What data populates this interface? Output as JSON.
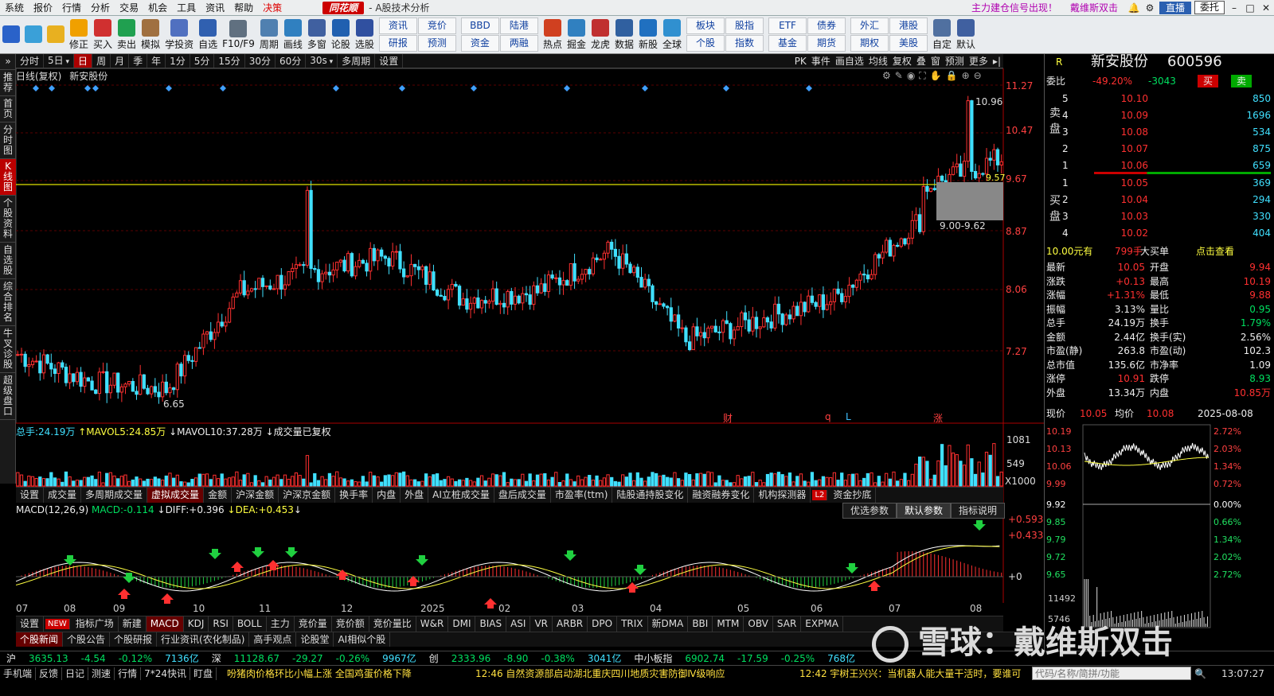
{
  "menubar": {
    "items": [
      "系统",
      "报价",
      "行情",
      "分析",
      "交易",
      "机会",
      "工具",
      "资讯",
      "帮助",
      "决策"
    ],
    "brand": "同花顺",
    "subtitle": "- A股技术分析",
    "promo1": "主力建仓信号出现！",
    "promo2": "戴维斯双击",
    "live": "直播",
    "commission": "委托",
    "win_min": "–",
    "win_max": "□",
    "win_close": "✕"
  },
  "toolbar": {
    "buttons": [
      {
        "label": "",
        "color": "#2a62c9"
      },
      {
        "label": "",
        "color": "#3aa0d8"
      },
      {
        "label": "",
        "color": "#e8b020"
      },
      {
        "label": "修正",
        "color": "#f0a000"
      },
      {
        "label": "买入",
        "color": "#d03030"
      },
      {
        "label": "卖出",
        "color": "#20a050"
      },
      {
        "label": "模拟",
        "color": "#a07040"
      },
      {
        "label": "学投资",
        "color": "#5070c0"
      },
      {
        "label": "自选",
        "color": "#3060b0"
      },
      {
        "label": "F10/F9",
        "color": "#607080"
      },
      {
        "label": "周期",
        "color": "#5080b0"
      },
      {
        "label": "画线",
        "color": "#3080c0"
      },
      {
        "label": "多窗",
        "color": "#4060a0"
      },
      {
        "label": "论股",
        "color": "#2060b0"
      },
      {
        "label": "选股",
        "color": "#3050a0"
      }
    ],
    "grid1": [
      "资讯",
      "竞价",
      "研报",
      "预测"
    ],
    "grid2": [
      "BBD",
      "陆港",
      "资金",
      "两融"
    ],
    "buttons2": [
      {
        "label": "热点",
        "color": "#d04020"
      },
      {
        "label": "掘金",
        "color": "#3080c0"
      },
      {
        "label": "龙虎",
        "color": "#c03030"
      },
      {
        "label": "数据",
        "color": "#3060a0"
      },
      {
        "label": "新股",
        "color": "#2070c0"
      },
      {
        "label": "全球",
        "color": "#3090d0"
      }
    ],
    "grid3": [
      "板块",
      "股指",
      "个股",
      "指数"
    ],
    "grid4": [
      "ETF",
      "债券",
      "基金",
      "期货"
    ],
    "grid5": [
      "外汇",
      "港股",
      "期权",
      "美股"
    ],
    "buttons3": [
      {
        "label": "自定",
        "color": "#5070a0"
      },
      {
        "label": "默认",
        "color": "#4060a0"
      }
    ]
  },
  "leftnav": [
    {
      "label": "推荐",
      "active": false
    },
    {
      "label": "首页",
      "active": false
    },
    {
      "label": "分时图",
      "active": false
    },
    {
      "label": "K线图",
      "active": true
    },
    {
      "label": "个股资料",
      "active": false
    },
    {
      "label": "自选股",
      "active": false
    },
    {
      "label": "综合排名",
      "active": false
    },
    {
      "label": "牛叉诊股",
      "active": false
    },
    {
      "label": "超级盘口",
      "active": false
    }
  ],
  "periodbar": {
    "tabs": [
      {
        "label": "分时",
        "drop": false
      },
      {
        "label": "5日",
        "drop": true
      },
      {
        "label": "日",
        "drop": false,
        "active": true
      },
      {
        "label": "周",
        "drop": false
      },
      {
        "label": "月",
        "drop": false
      },
      {
        "label": "季",
        "drop": false
      },
      {
        "label": "年",
        "drop": false
      },
      {
        "label": "1分",
        "drop": false
      },
      {
        "label": "5分",
        "drop": false
      },
      {
        "label": "15分",
        "drop": false
      },
      {
        "label": "30分",
        "drop": false
      },
      {
        "label": "60分",
        "drop": false
      },
      {
        "label": "30s",
        "drop": true
      },
      {
        "label": "多周期",
        "drop": false
      },
      {
        "label": "设置",
        "drop": false
      }
    ],
    "right": [
      "PK",
      "事件",
      "画自选",
      "均线",
      "复权",
      "叠",
      "窗",
      "预测",
      "更多"
    ]
  },
  "kline": {
    "title": "日线(复权)",
    "stock": "新安股份",
    "high_label": "10.96",
    "low_label": "6.65",
    "zone_label": "9.00-9.62",
    "line_label": "9.57",
    "markers": [
      "财",
      "q",
      "L",
      "涨"
    ],
    "price_axis": [
      "11.27",
      "10.47",
      "9.67",
      "8.87",
      "8.06",
      "7.27"
    ]
  },
  "volume": {
    "total_label": "总手:",
    "total": "24.19万",
    "ma5_label": "MAVOL5:",
    "ma5": "24.85万",
    "ma10_label": "MAVOL10:",
    "ma10": "37.28万",
    "note": "成交量已复权",
    "axis": [
      "1081",
      "549",
      "X1000"
    ]
  },
  "tabs1": [
    "设置",
    "成交量",
    "多周期成交量",
    "虚拟成交量",
    "金额",
    "沪深金额",
    "沪深京金额",
    "换手率",
    "内盘",
    "外盘",
    "AI立桩成交量",
    "盘后成交量",
    "市盈率(ttm)",
    "陆股通持股变化",
    "融资融券变化",
    "机构探测器",
    "L2",
    "资金抄底"
  ],
  "macd": {
    "title": "MACD(12,26,9)",
    "macd_label": "MACD:",
    "macd": "-0.114",
    "diff_label": "DIFF:",
    "diff": "+0.396",
    "dea_label": "DEA:",
    "dea": "+0.453",
    "axis": [
      "+0.593",
      "+0.433",
      "+0"
    ],
    "opts": [
      "优选参数",
      "默认参数",
      "指标说明"
    ]
  },
  "months": [
    "07",
    "08",
    "09",
    "10",
    "11",
    "12",
    "2025",
    "02",
    "03",
    "04",
    "05",
    "06",
    "07",
    "08"
  ],
  "tabs2": [
    "设置",
    "NEW",
    "指标广场",
    "新建",
    "MACD",
    "KDJ",
    "RSI",
    "BOLL",
    "主力",
    "竞价量",
    "竞价额",
    "竞价量比",
    "W&R",
    "DMI",
    "BIAS",
    "ASI",
    "VR",
    "ARBR",
    "DPO",
    "TRIX",
    "新DMA",
    "BBI",
    "MTM",
    "OBV",
    "SAR",
    "EXPMA"
  ],
  "tabs3": [
    "个股新闻",
    "个股公告",
    "个股研报",
    "行业资讯(农化制品)",
    "高手观点",
    "论股堂",
    "AI相似个股"
  ],
  "index": [
    {
      "name": "沪",
      "val": "3635.13",
      "chg": "-4.54",
      "pct": "-0.12%",
      "amt": "7136亿"
    },
    {
      "name": "深",
      "val": "11128.67",
      "chg": "-29.27",
      "pct": "-0.26%",
      "amt": "9967亿"
    },
    {
      "name": "创",
      "val": "2333.96",
      "chg": "-8.90",
      "pct": "-0.38%",
      "amt": "3041亿"
    },
    {
      "name": "中小板指",
      "val": "6902.74",
      "chg": "-17.59",
      "pct": "-0.25%",
      "amt": "768亿"
    }
  ],
  "status": {
    "items": [
      "手机端",
      "反馈",
      "日记",
      "测速",
      "行情",
      "7*24快讯",
      "盯盘"
    ],
    "news1": "吩猪肉价格环比小幅上涨 全国鸡蛋价格下降",
    "news2": "12:46 自然资源部启动湖北重庆四川地质灾害防御Ⅳ级响应",
    "news3": "12:42 宇树王兴兴：当机器人能大量干活时，要谁可",
    "search_placeholder": "代码/名称/简拼/功能",
    "time": "13:07:27"
  },
  "right": {
    "r": "R",
    "name": "新安股份",
    "code": "600596",
    "weibi_label": "委比",
    "weibi": "-49.20%",
    "weicha": "-3043",
    "buy_btn": "买",
    "sell_btn": "卖",
    "sell_label": "卖盘",
    "buy_label": "买盘",
    "asks": [
      {
        "lv": "5",
        "p": "10.10",
        "v": "850"
      },
      {
        "lv": "4",
        "p": "10.09",
        "v": "1696"
      },
      {
        "lv": "3",
        "p": "10.08",
        "v": "534"
      },
      {
        "lv": "2",
        "p": "10.07",
        "v": "875"
      },
      {
        "lv": "1",
        "p": "10.06",
        "v": "659"
      }
    ],
    "bids": [
      {
        "lv": "1",
        "p": "10.05",
        "v": "369"
      },
      {
        "lv": "2",
        "p": "10.04",
        "v": "294"
      },
      {
        "lv": "3",
        "p": "10.03",
        "v": "330"
      },
      {
        "lv": "4",
        "p": "10.02",
        "v": "404"
      }
    ],
    "big_price": "10.00元有",
    "big_hands": "799手",
    "big_text": "大买单",
    "big_link": "点击查看",
    "quote": [
      [
        "最新",
        "10.05",
        "开盘",
        "9.94"
      ],
      [
        "涨跌",
        "+0.13",
        "最高",
        "10.19"
      ],
      [
        "涨幅",
        "+1.31%",
        "最低",
        "9.88"
      ],
      [
        "振幅",
        "3.13%",
        "量比",
        "0.95"
      ],
      [
        "总手",
        "24.19万",
        "换手",
        "1.79%"
      ],
      [
        "金额",
        "2.44亿",
        "换手(实)",
        "2.56%"
      ],
      [
        "市盈(静)",
        "263.8",
        "市盈(动)",
        "102.3"
      ],
      [
        "总市值",
        "135.6亿",
        "市净率",
        "1.09"
      ],
      [
        "涨停",
        "10.91",
        "跌停",
        "8.93"
      ],
      [
        "外盘",
        "13.34万",
        "内盘",
        "10.85万"
      ]
    ],
    "mini": {
      "now_label": "现价",
      "now": "10.05",
      "avg_label": "均价",
      "avg": "10.08",
      "date": "2025-08-08",
      "left_axis": [
        "10.19",
        "10.13",
        "10.06",
        "9.99",
        "9.92",
        "9.85",
        "9.79",
        "9.72",
        "9.65"
      ],
      "right_axis": [
        "2.72%",
        "2.03%",
        "1.34%",
        "0.72%",
        "0.00%",
        "0.66%",
        "1.34%",
        "2.02%",
        "2.72%"
      ],
      "vol_axis": [
        "11492",
        "5746"
      ]
    }
  },
  "watermark": "雪球：戴维斯双击",
  "chart_data": {
    "type": "candlestick",
    "x_range": [
      "2024-07",
      "2025-08"
    ],
    "ylim": [
      6.65,
      11.27
    ],
    "monthly_closes": [
      {
        "m": "07",
        "v": 7.4
      },
      {
        "m": "08",
        "v": 7.0
      },
      {
        "m": "09",
        "v": 6.9
      },
      {
        "m": "10",
        "v": 8.3
      },
      {
        "m": "11",
        "v": 8.6
      },
      {
        "m": "12",
        "v": 8.8
      },
      {
        "m": "2025",
        "v": 8.2
      },
      {
        "m": "02",
        "v": 8.3
      },
      {
        "m": "03",
        "v": 8.9
      },
      {
        "m": "04",
        "v": 7.6
      },
      {
        "m": "05",
        "v": 7.9
      },
      {
        "m": "06",
        "v": 8.2
      },
      {
        "m": "07",
        "v": 9.2
      },
      {
        "m": "08",
        "v": 10.05
      }
    ]
  }
}
